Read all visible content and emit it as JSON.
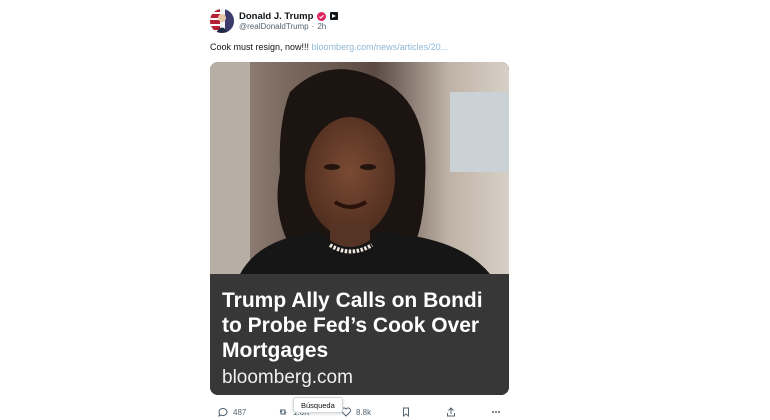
{
  "post": {
    "author": {
      "display_name": "Donald J. Trump",
      "handle": "@realDonaldTrump",
      "time": "2h",
      "verified_color": "#e0245e"
    },
    "text": "Cook must resign, now!!! ",
    "link_text": "bloomberg.com/news/articles/20..."
  },
  "card": {
    "headline": "Trump Ally Calls on Bondi to Probe Fed’s Cook Over Mortgages",
    "domain": "bloomberg.com"
  },
  "actions": {
    "reply_count": "487",
    "repost_count": "1.6K",
    "like_count": "8.8k",
    "tooltip": "Búsqueda"
  },
  "icons": [
    "reply-icon",
    "repost-icon",
    "like-icon",
    "bookmark-icon",
    "share-icon",
    "more-icon",
    "verified-icon",
    "badge-icon"
  ]
}
